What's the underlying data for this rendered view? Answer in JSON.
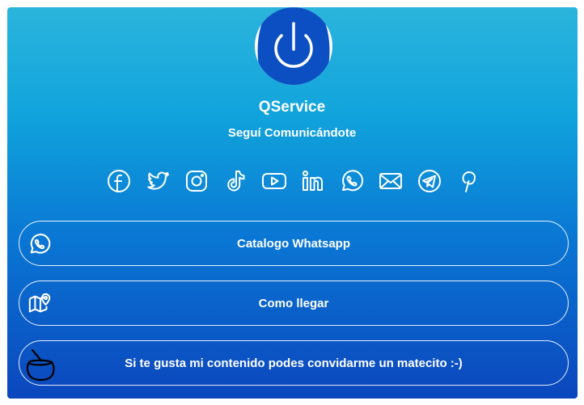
{
  "profile": {
    "name": "QService",
    "tagline": "Seguí Comunicándote",
    "avatar_icon": "power-icon"
  },
  "social_icons": [
    "facebook-icon",
    "twitter-icon",
    "instagram-icon",
    "tiktok-icon",
    "youtube-icon",
    "linkedin-icon",
    "whatsapp-icon",
    "mail-icon",
    "telegram-icon",
    "pinterest-icon"
  ],
  "links": [
    {
      "label": "Catalogo Whatsapp",
      "icon": "whatsapp-icon"
    },
    {
      "label": "Como llegar",
      "icon": "map-pin-icon"
    },
    {
      "label": "Si te gusta mi contenido podes convidarme un matecito :-)",
      "icon": "mate-icon"
    }
  ],
  "colors": {
    "gradient_top": "#2bb5dc",
    "gradient_bottom": "#0b46bd",
    "avatar_blue": "#0c4fc3",
    "text": "#ffffff"
  }
}
